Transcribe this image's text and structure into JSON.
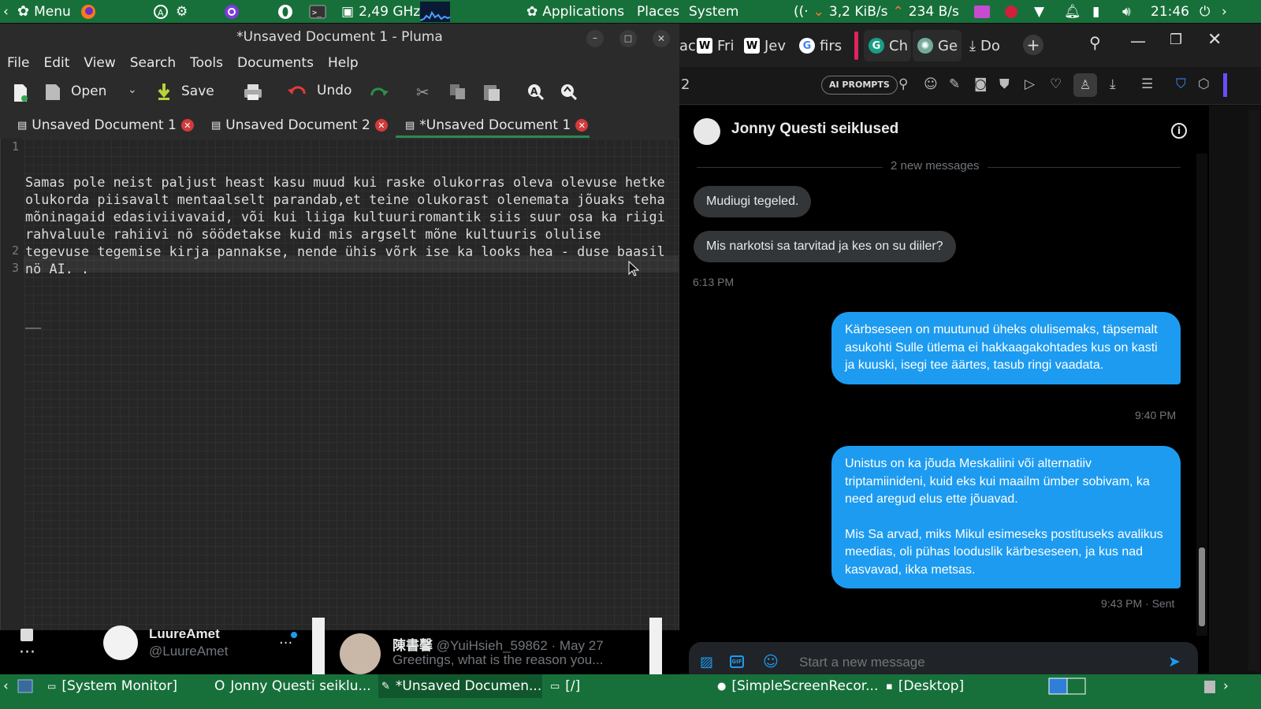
{
  "top_panel": {
    "menu_label": "Menu",
    "cpu_freq": "2,49 GHz",
    "applications": "Applications",
    "places": "Places",
    "system": "System",
    "net_down": "3,2 KiB/s",
    "net_up": "234 B/s",
    "clock": "21:46"
  },
  "pluma": {
    "title": "*Unsaved Document 1 - Pluma",
    "menu": [
      "File",
      "Edit",
      "View",
      "Search",
      "Tools",
      "Documents",
      "Help"
    ],
    "toolbar": {
      "open": "Open",
      "save": "Save",
      "undo": "Undo"
    },
    "tabs": [
      {
        "label": "Unsaved Document 1"
      },
      {
        "label": "Unsaved Document 2"
      },
      {
        "label": "*Unsaved Document 1"
      }
    ],
    "line_numbers": [
      "1",
      "2",
      "3"
    ],
    "text_line1": "Samas pole neist paljust heast kasu muud kui raske olukorras oleva olevuse hetke olukorda piisavalt mentaalselt parandab,et teine olukorast olenemata jõuaks teha mõninagaid edasiviivavaid, või kui liiga kultuuriromantik siis suur osa ka riigi rahvaluule rahiivi nö söödetakse kuid mis argselt mõne kultuuris olulise tegevuse tegemise kirja pannakse, nende ühis võrk ise ka looks hea - duse baasil nö AI. .",
    "text_line2": "__"
  },
  "browser": {
    "tabs": [
      "ac",
      "Fri",
      "Jev",
      "firs",
      "Ch",
      "Ge",
      "Do"
    ],
    "toolbar_num": "2",
    "ai_prompts": "AI PROMPTS"
  },
  "chat": {
    "title": "Jonny Questi seiklused",
    "new_messages": "2 new messages",
    "incoming": [
      "Mudiugi tegeled.",
      "Mis narkotsi sa tarvitad ja kes on su diiler?"
    ],
    "incoming_time": "6:13 PM",
    "outgoing1": "Kärbseseen on muutunud üheks olulisemaks, täpsemalt asukohti Sulle ütlema ei hakkaagakohtades kus on kasti ja kuuski, isegi tee äärtes, tasub ringi vaadata.",
    "outgoing1_time": "9:40 PM",
    "outgoing2_p1": "Unistus on ka jõuda Meskaliini või alternatiiv triptamiinideni, kuid eks kui maailm ümber sobivam, ka need aregud elus ette jõuavad.",
    "outgoing2_p2": "Mis Sa arvad, miks Mikul esimeseks postituseks avalikus meedias, oli pühas looduslik kärbeseseen, ja kus nad kasvavad, ikka metsas.",
    "outgoing2_time": "9:43 PM · Sent",
    "composer_placeholder": "Start a new message"
  },
  "strip": {
    "account_name": "LuureAmet",
    "account_handle": "@LuureAmet",
    "tweet_name": "陳書馨",
    "tweet_handle": "@YuiHsieh_59862 · May 27",
    "tweet_text": "Greetings, what is the reason you..."
  },
  "taskbar": {
    "items": [
      "[System Monitor]",
      "Jonny Questi seiklu...",
      "*Unsaved Documen...",
      "[/]",
      "[SimpleScreenRecor...",
      "[Desktop]"
    ]
  }
}
